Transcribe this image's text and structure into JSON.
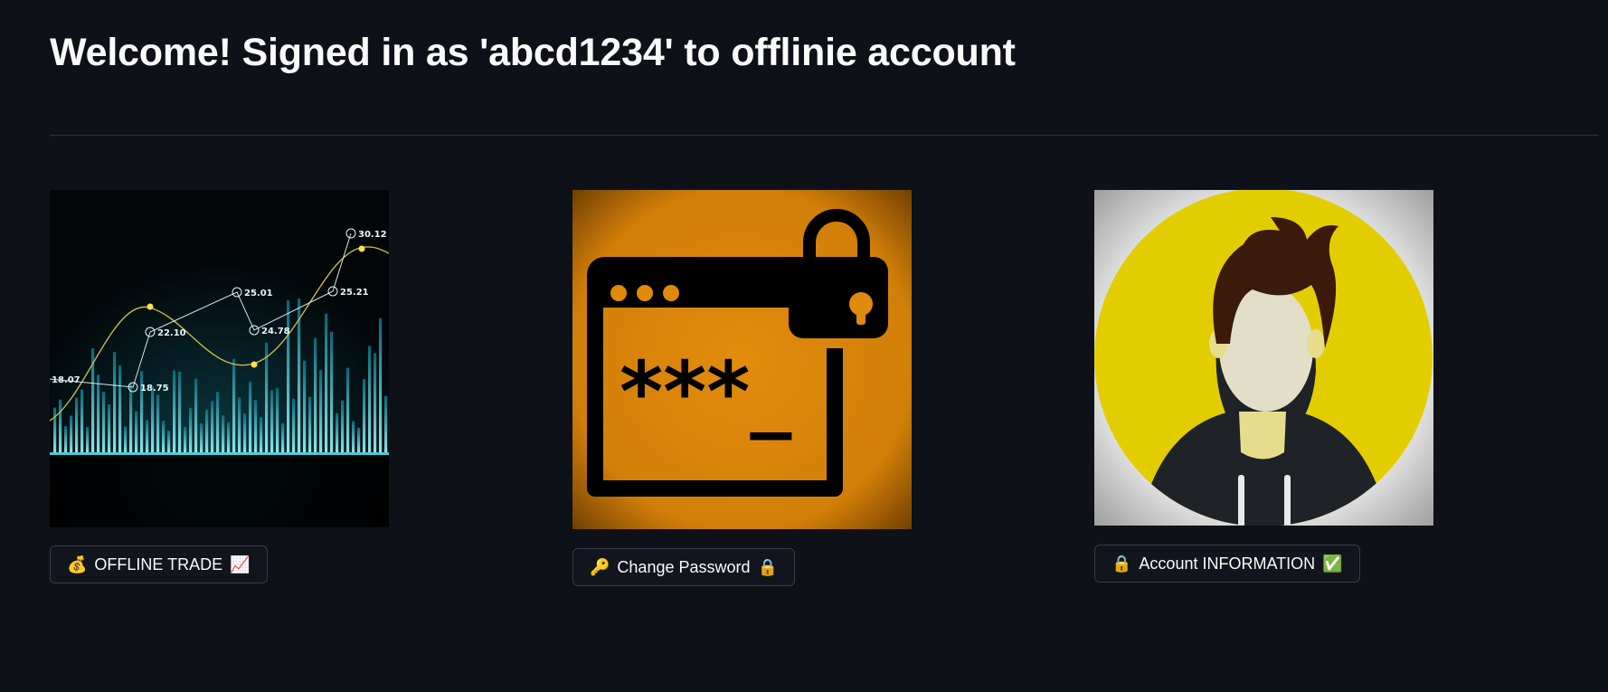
{
  "header": {
    "title": "Welcome! Signed in as 'abcd1234' to offlinie account"
  },
  "cards": [
    {
      "image_name": "stock-chart-image",
      "chart_labels": [
        "18.07",
        "18.75",
        "22.10",
        "25.01",
        "24.78",
        "25.21",
        "30.12"
      ],
      "button": {
        "icon_left": "💰",
        "label": "OFFLINE TRADE",
        "icon_right": "📈"
      }
    },
    {
      "image_name": "password-lock-image",
      "image_text": "***_",
      "button": {
        "icon_left": "🔑",
        "label": "Change Password",
        "icon_right": "🔒"
      }
    },
    {
      "image_name": "user-avatar-image",
      "button": {
        "icon_left": "🔒",
        "label": "Account INFORMATION",
        "icon_right": "✅"
      }
    }
  ],
  "colors": {
    "background": "#0e1117",
    "text": "#fafafa",
    "divider": "#31333f",
    "button_border": "#3a3d47",
    "password_bg": "#d9830b",
    "avatar_bg": "#e2ce00"
  }
}
